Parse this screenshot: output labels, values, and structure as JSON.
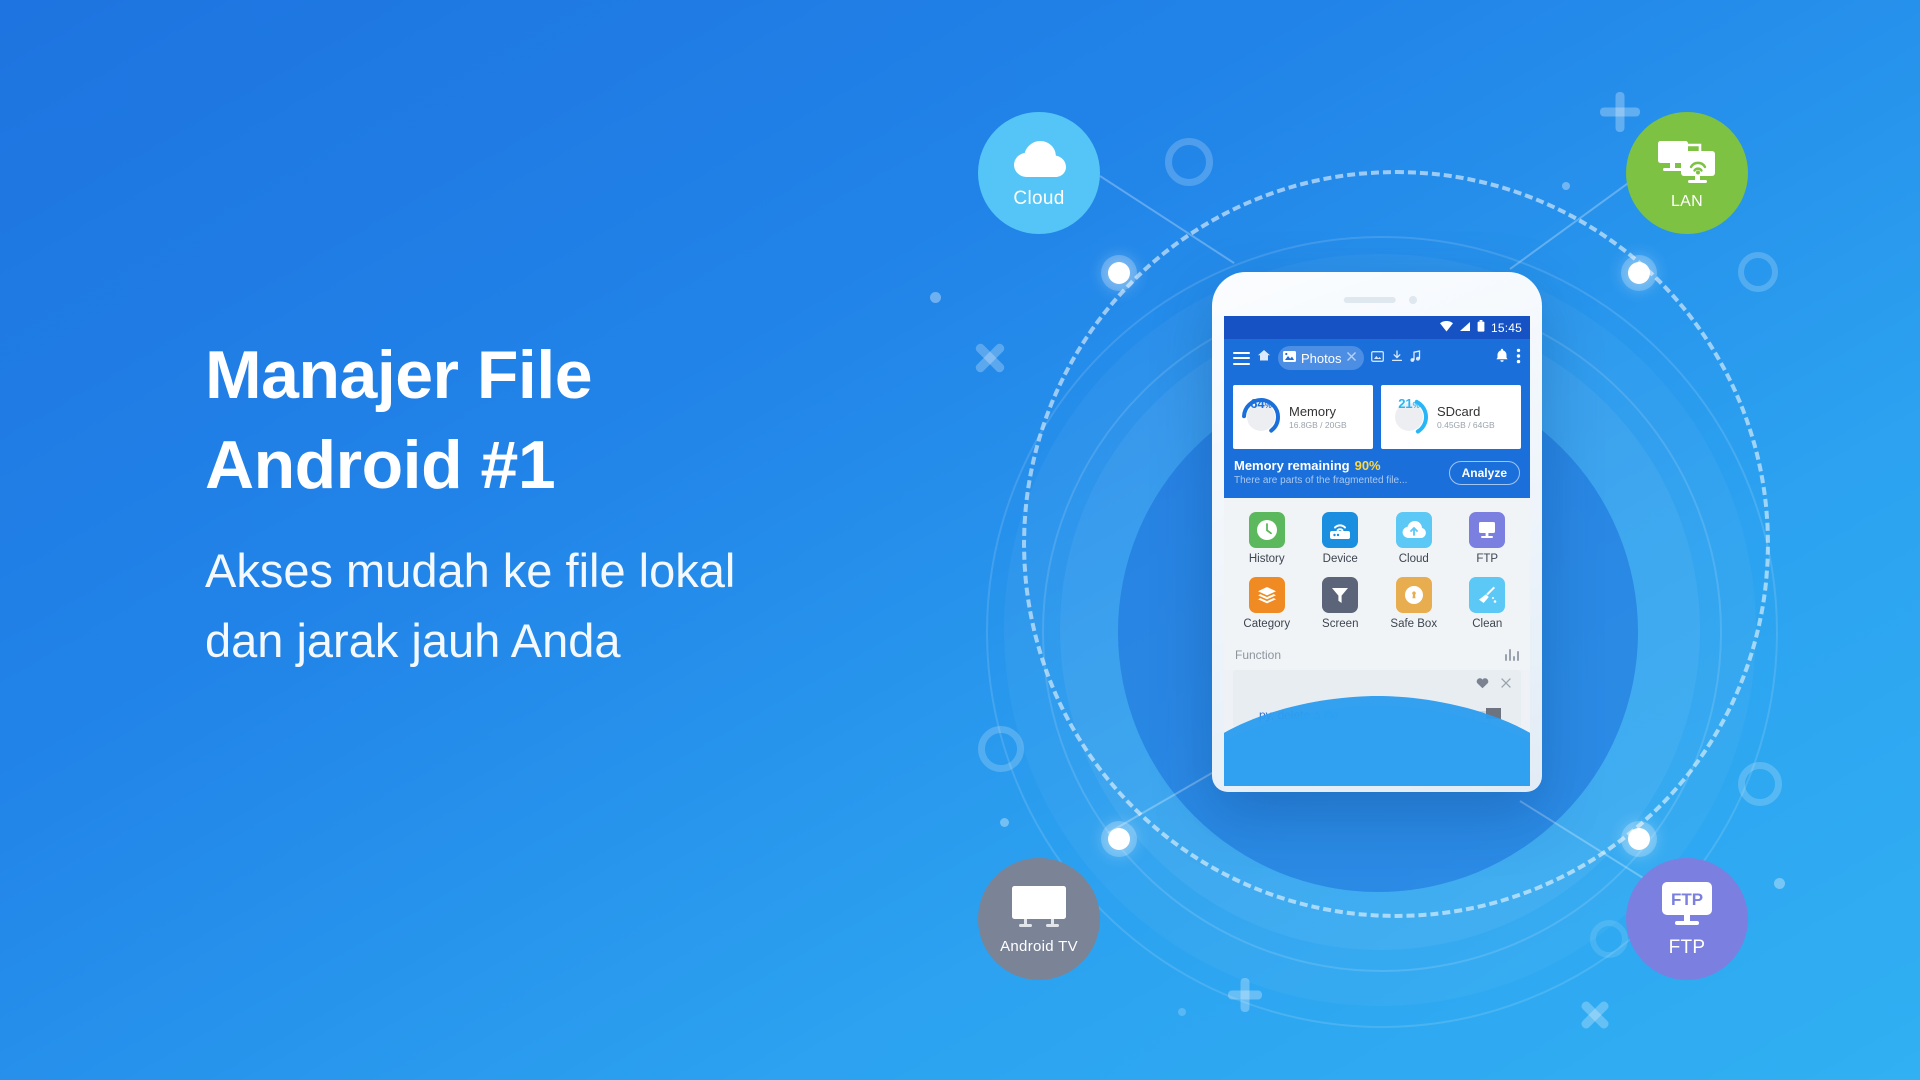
{
  "hero": {
    "headline": "Manajer File\nAndroid #1",
    "subhead": "Akses mudah ke file lokal\ndan jarak jauh Anda"
  },
  "colors": {
    "bg_top": "#1e74e0",
    "bg_bottom": "#31b0f3",
    "toolbar_blue": "#1a6fdb",
    "statusbar_blue": "#1652c4",
    "accent_yellow": "#ffd740",
    "cloud_badge": "#54c5f6",
    "lan_badge": "#7dc242",
    "tv_badge": "#7b8397",
    "ftp_badge": "#7b7fe0"
  },
  "badges": [
    {
      "id": "cloud",
      "label": "Cloud",
      "icon": "cloud-icon",
      "color": "#54c5f6"
    },
    {
      "id": "lan",
      "label": "LAN",
      "icon": "lan-monitors-icon",
      "color": "#7dc242"
    },
    {
      "id": "tv",
      "label": "Android TV",
      "icon": "tv-icon",
      "color": "#7b8397"
    },
    {
      "id": "ftp",
      "label": "FTP",
      "icon": "ftp-monitor-icon",
      "color": "#7b7fe0"
    }
  ],
  "phone": {
    "statusbar": {
      "time": "15:45",
      "icons": [
        "wifi-icon",
        "signal-icon",
        "battery-icon"
      ]
    },
    "toolbar": {
      "menu_icon": "hamburger-menu-icon",
      "home_icon": "home-icon",
      "tab_label": "Photos",
      "tab_icon": "image-icon",
      "tab_close_icon": "close-icon",
      "quick_icons": [
        "image-icon",
        "download-icon",
        "music-icon"
      ],
      "bell_icon": "bell-icon",
      "overflow_icon": "overflow-menu-icon"
    },
    "storage_cards": [
      {
        "name": "Memory",
        "percent": "64",
        "percent_symbol": "%",
        "size": "16.8GB / 20GB",
        "ring_color": "#1a6fdb",
        "value": 64
      },
      {
        "name": "SDcard",
        "percent": "21",
        "percent_symbol": "%",
        "size": "0.45GB / 64GB",
        "ring_color": "#29b6f6",
        "value": 21
      }
    ],
    "memory_banner": {
      "title": "Memory remaining",
      "percent": "90%",
      "subtitle": "There are parts of the fragmented file...",
      "button_label": "Analyze"
    },
    "grid": [
      {
        "label": "History",
        "icon": "clock-icon",
        "color": "#5cb85c"
      },
      {
        "label": "Device",
        "icon": "router-icon",
        "color": "#1a8fe0"
      },
      {
        "label": "Cloud",
        "icon": "cloud-upload-icon",
        "color": "#5bc8f5"
      },
      {
        "label": "FTP",
        "icon": "ftp-monitor-icon",
        "color": "#7b7fe0"
      },
      {
        "label": "Category",
        "icon": "layers-icon",
        "color": "#ef8b22"
      },
      {
        "label": "Screen",
        "icon": "funnel-icon",
        "color": "#5b6478"
      },
      {
        "label": "Safe Box",
        "icon": "lock-icon",
        "color": "#e8ad4e"
      },
      {
        "label": "Clean",
        "icon": "broom-icon",
        "color": "#5bc8f5"
      }
    ],
    "function_section": {
      "label": "Function",
      "sort_icon": "sort-bars-icon"
    },
    "bottom_card": {
      "text": "py, delete a file",
      "heart_icon": "heart-icon",
      "close_icon": "close-icon"
    }
  }
}
